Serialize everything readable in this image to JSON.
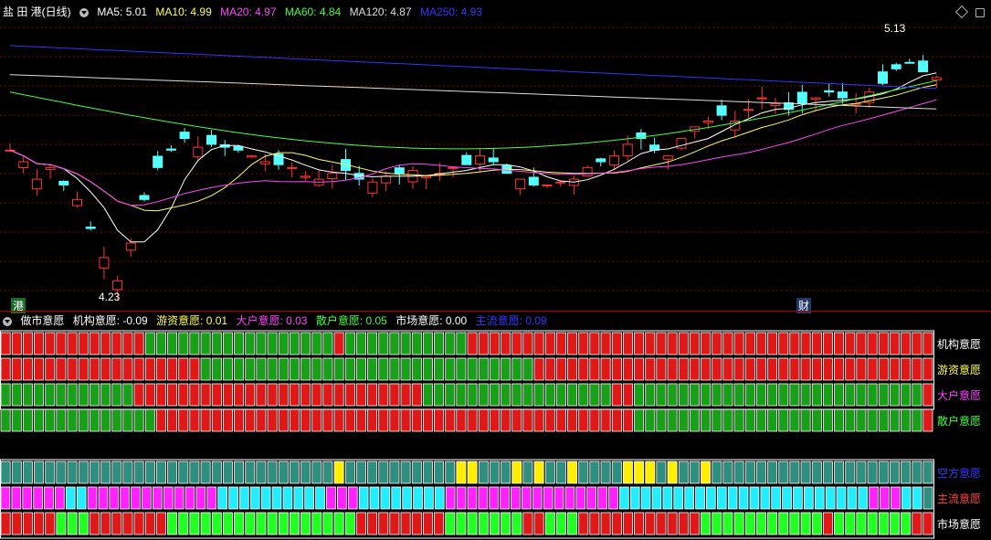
{
  "header": {
    "title": "盐 田 港(日线)",
    "ma": [
      {
        "label": "MA5: 5.01",
        "color": "#ffffff"
      },
      {
        "label": "MA10: 4.99",
        "color": "#ffff55"
      },
      {
        "label": "MA20: 4.97",
        "color": "#ff44ff"
      },
      {
        "label": "MA60: 4.84",
        "color": "#44ff44"
      },
      {
        "label": "MA120: 4.87",
        "color": "#dddddd"
      },
      {
        "label": "MA250: 4.93",
        "color": "#3333ff"
      }
    ]
  },
  "price": {
    "high_label": "5.13",
    "low_label": "4.23",
    "marker_left": "港",
    "marker_right": "财"
  },
  "indicator": {
    "name": "做市意愿",
    "values": [
      {
        "label": "机构意愿: -0.09",
        "color": "#ffffff"
      },
      {
        "label": "游资意愿: 0.01",
        "color": "#ffff55"
      },
      {
        "label": "大户意愿: 0.03",
        "color": "#ff44ff"
      },
      {
        "label": "散户意愿: 0.05",
        "color": "#44ff44"
      },
      {
        "label": "市场意愿: 0.00",
        "color": "#ffffff"
      },
      {
        "label": "主流意愿: 0.09",
        "color": "#3333ff"
      }
    ],
    "row_labels": [
      {
        "label": "机构意愿",
        "color": "#ffffff"
      },
      {
        "label": "游资意愿",
        "color": "#ffff55"
      },
      {
        "label": "大户意愿",
        "color": "#ff44ff"
      },
      {
        "label": "散户意愿",
        "color": "#44ff44"
      },
      {
        "label": "空方意愿",
        "color": "#3333ff"
      },
      {
        "label": "主流意愿",
        "color": "#ff4444"
      },
      {
        "label": "市场意愿",
        "color": "#ffffff"
      }
    ],
    "rows": [
      "RRRRRRRRRRRRRGGGGGGGGGGGGGGGGGRGGGGGGGGGGGRRRRRRRRRRRRRRRRRRRRRRRRRRRRRRRRRRRRRRRRRR",
      "RRRRRRRRRRRRRRRRRRGGGGGGGGGGGGGGGGGGGGGGGGGGGGGGRRRRRRRRRRRRRRRRRRRRRRRRRRRRRRRRRRRR",
      "GGGGGGGGGGGGRRRRRRRRRRRRRRRRRRRRRRRRRRGGGGGGGGGGGGGGGGGRRGGGGGGGGGGGGGGGGGGGGGGGGGGR",
      "GGGGGGGGGGGGGGRRRRRRRRRRRRRRRRRRRRRRRRRRRRRRRRRRRRRRRRRRRGGGGGGGGGGGGGGGGGGGGGGGGGGR",
      "TTTTTTTTTTTTTTTTTTTTTTTTTTTTTTYTTTTTTTTTTYYTTTYTYTTYTTTTYYYTYTTYTTTTTTTTTTTTTTTTTTTT",
      "MMMMMMCCMMMMMMMMMMMMCCCCCCCCCCMMMCCCCCCCCMMMMMMMMMMMMMMMMCCCCCCCCCCCCCCCCCCCCCCCMMMCCT",
      "RRRRRGGGRRRRRRRGGGGGGGGGGGGGGGGGRRRRRRRRGGGGGGGRRGGGRRRRRRRRRRRGGGGGGGGGGGRGGGGGGGRR"
    ]
  },
  "chart_data": {
    "type": "candlestick",
    "ma_lines": [
      "MA5",
      "MA10",
      "MA20",
      "MA60",
      "MA120",
      "MA250"
    ],
    "price_high": 5.13,
    "price_low": 4.23
  },
  "colors": {
    "up": "#ff3232",
    "down": "#54ffff",
    "grid": "#800000",
    "cell_red": "#e01818",
    "cell_green": "#18a018",
    "cell_teal": "#2f8f7f",
    "cell_yellow": "#ffee00",
    "cell_magenta": "#ff22ff",
    "cell_cyan": "#22eeff",
    "cell_lime": "#22ff22"
  }
}
